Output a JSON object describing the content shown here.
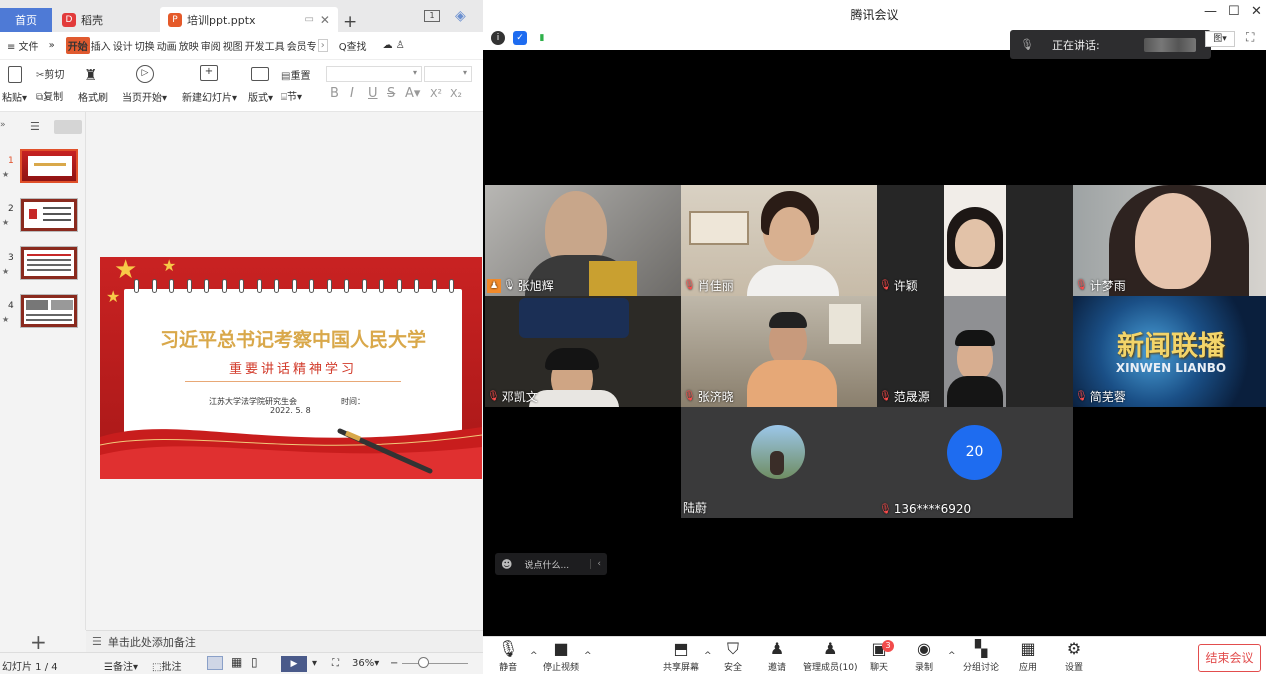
{
  "colors": {
    "wps_accent": "#e05a2f",
    "wps_home_tab": "#4e7ad6",
    "meet_end": "#e24d4d",
    "mic_muted": "#ff4c4c",
    "avatar_blue": "#1e6cf0"
  },
  "wps": {
    "tabs": [
      {
        "label": "首页"
      },
      {
        "label": "稻壳"
      },
      {
        "label": "培训ppt.pptx"
      }
    ],
    "menu": {
      "file": "≡ 文件",
      "chevron": "»",
      "items": [
        "开始",
        "插入",
        "设计",
        "切换",
        "动画",
        "放映",
        "审阅",
        "视图",
        "开发工具",
        "会员专"
      ],
      "more": "›",
      "search": "Q查找"
    },
    "ribbon": {
      "paste": "粘贴",
      "cut": "剪切",
      "copy": "复制",
      "format_painter": "格式刷",
      "from_current": "当页开始",
      "new_slide": "新建幻灯片",
      "layout": "版式",
      "reset": "重置",
      "section": "节",
      "bold": "B",
      "italic": "I",
      "underline": "U",
      "strike": "S",
      "font_color": "A",
      "superscript": "X²",
      "subscript": "X₂"
    },
    "slides": [
      {
        "num": "1"
      },
      {
        "num": "2"
      },
      {
        "num": "3"
      },
      {
        "num": "4"
      }
    ],
    "slide": {
      "title": "习近平总书记考察中国人民大学",
      "subtitle": "重要讲话精神学习",
      "org": "江苏大学法学院研究生会",
      "time_label": "时间：",
      "date": "2022. 5. 8"
    },
    "notes_hint": "单击此处添加备注",
    "status": {
      "slide_count": "幻灯片 1 / 4",
      "notes": "备注",
      "comments": "批注",
      "zoom": "36%"
    }
  },
  "meeting": {
    "title": "腾讯会议",
    "speaking_label": "正在讲话:",
    "participants": [
      {
        "name": "张旭辉",
        "muted": false
      },
      {
        "name": "肖佳丽",
        "muted": true
      },
      {
        "name": "许颖",
        "muted": true
      },
      {
        "name": "计梦雨",
        "muted": true
      },
      {
        "name": "邓凯文",
        "muted": true
      },
      {
        "name": "张济晓",
        "muted": true
      },
      {
        "name": "范晟源",
        "muted": true
      },
      {
        "name": "简芜蓉",
        "muted": true
      },
      {
        "name": "陆蔚",
        "muted": false
      },
      {
        "name": "136****6920",
        "muted": true,
        "avatar_text": "20"
      }
    ],
    "news_logo": {
      "line1": "新闻联播",
      "line2": "XINWEN LIANBO"
    },
    "chat_placeholder": "说点什么...",
    "toolbar": {
      "mute": "静音",
      "stop_video": "停止视频",
      "share": "共享屏幕",
      "security": "安全",
      "invite": "邀请",
      "members": "管理成员(10)",
      "chat": "聊天",
      "chat_badge": "3",
      "record": "录制",
      "breakout": "分组讨论",
      "apps": "应用",
      "settings": "设置",
      "end": "结束会议"
    }
  }
}
